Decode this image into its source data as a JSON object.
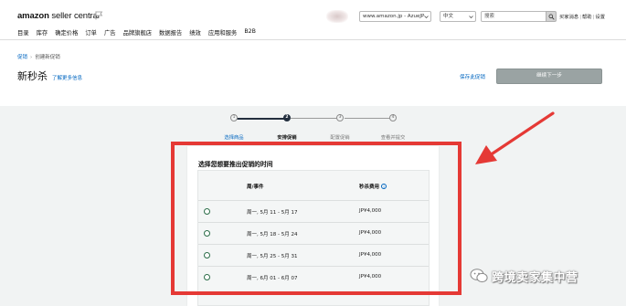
{
  "header": {
    "logo_brand": "amazon",
    "logo_sub": " seller central",
    "store_select": "www.amazon.jp - AzueJP",
    "lang_select": "中文",
    "search_placeholder": "搜索",
    "links": [
      "买家消息",
      "帮助",
      "设置"
    ]
  },
  "nav": {
    "items": [
      "目录",
      "库存",
      "确定价格",
      "订单",
      "广告",
      "品牌旗舰店",
      "数据报告",
      "绩效",
      "应用和服务",
      "B2B"
    ]
  },
  "page": {
    "breadcrumb_root": "促销",
    "breadcrumb_current": "创建新促销",
    "title": "新秒杀",
    "learn_more": "了解更多信息",
    "save_draft": "保存此促销",
    "continue_button": "继续下一步"
  },
  "stepper": {
    "steps": [
      {
        "number": "1",
        "label": "选择商品",
        "state": "done"
      },
      {
        "number": "2",
        "label": "安排促销",
        "state": "active"
      },
      {
        "number": "3",
        "label": "配置促销",
        "state": "pending"
      },
      {
        "number": "4",
        "label": "查看并提交",
        "state": "pending"
      }
    ]
  },
  "schedule": {
    "title": "选择您想要推出促销的时间",
    "col_week": "周/事件",
    "col_fee": "秒杀费用",
    "rows": [
      {
        "week": "周一, 5月 11 - 5月 17",
        "fee": "JP¥4,000"
      },
      {
        "week": "周一, 5月 18 - 5月 24",
        "fee": "JP¥4,000"
      },
      {
        "week": "周一, 5月 25 - 5月 31",
        "fee": "JP¥4,000"
      },
      {
        "week": "周一, 6月 01 - 6月 07",
        "fee": "JP¥4,000"
      }
    ]
  },
  "watermark": {
    "text": "跨境卖家集中营"
  },
  "colors": {
    "highlight": "#e53935",
    "link": "#0066c0",
    "stepper_active": "#232f3e",
    "continue_button": "#9aa3a3"
  }
}
